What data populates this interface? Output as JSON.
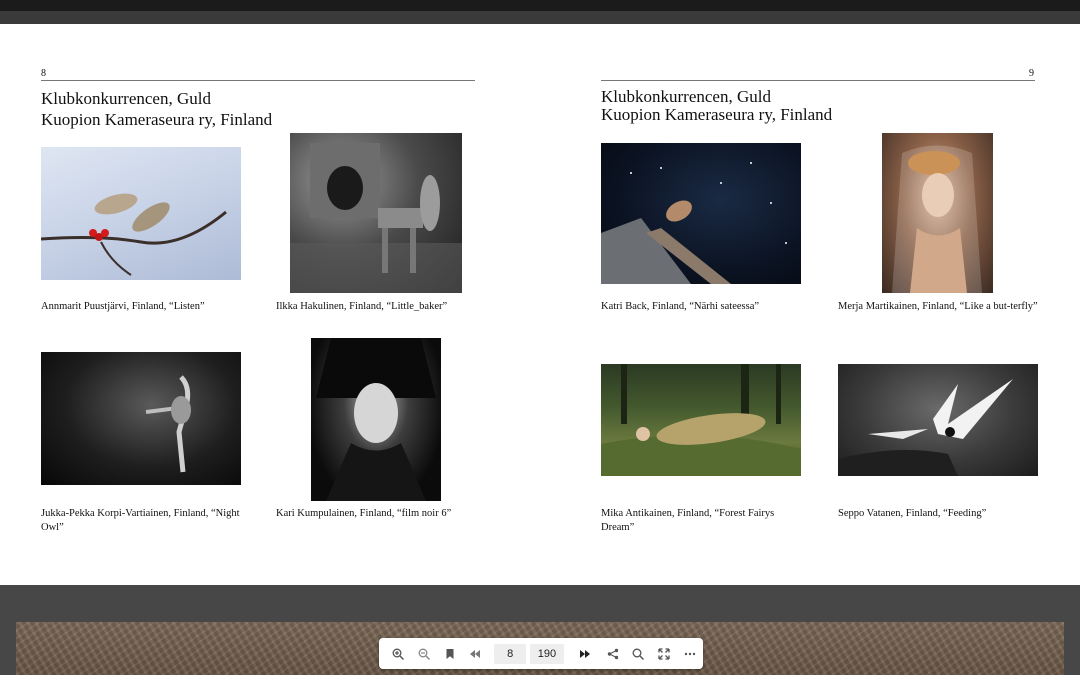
{
  "left_page": {
    "number": "8",
    "heading_line1": "Klubkonkurrencen, Guld",
    "heading_line2": "Kuopion Kameraseura ry, Finland",
    "photos": [
      {
        "caption": "Annmarit Puustjärvi, Finland, “Listen”"
      },
      {
        "caption": "Ilkka Hakulinen, Finland, “Little_baker”"
      },
      {
        "caption": "Jukka-Pekka Korpi-Vartiainen, Finland, “Night Owl”"
      },
      {
        "caption": "Kari Kumpulainen, Finland, “film noir 6”"
      }
    ]
  },
  "right_page": {
    "number": "9",
    "heading_line1": "Klubkonkurrencen, Guld",
    "heading_line2": "Kuopion Kameraseura ry, Finland",
    "photos": [
      {
        "caption": "Katri Back, Finland, “Närhi sateessa”"
      },
      {
        "caption": "Merja Martikainen, Finland, “Like a but-terfly”"
      },
      {
        "caption": "Mika Antikainen, Finland, “Forest Fairys Dream”"
      },
      {
        "caption": "Seppo Vatanen, Finland, “Feeding”"
      }
    ]
  },
  "toolbar": {
    "current_page": "8",
    "total_pages": "190",
    "icons": [
      "zoom-in-icon",
      "zoom-out-icon",
      "bookmark-icon",
      "first-page-icon",
      "last-page-icon",
      "share-icon",
      "search-icon",
      "fullscreen-icon",
      "more-icon"
    ]
  }
}
